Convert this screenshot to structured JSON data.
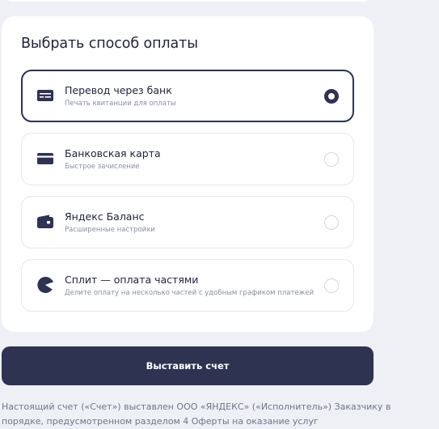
{
  "payment": {
    "title": "Выбрать способ оплаты",
    "options": [
      {
        "title": "Перевод через банк",
        "subtitle": "Печать квитанции для оплаты",
        "icon": "bank-transfer-icon",
        "selected": true
      },
      {
        "title": "Банковская карта",
        "subtitle": "Быстрое зачисление",
        "icon": "bank-card-icon",
        "selected": false
      },
      {
        "title": "Яндекс Баланс",
        "subtitle": "Расширенные настройки",
        "icon": "wallet-icon",
        "selected": false
      },
      {
        "title": "Сплит — оплата частями",
        "subtitle": "Делите оплату на несколько частей с удобным графиком платежей",
        "icon": "split-icon",
        "selected": false
      }
    ]
  },
  "actions": {
    "submit_label": "Выставить счет"
  },
  "legal": {
    "text": "Настоящий счет («Счет») выставлен ООО «ЯНДЕКС» («Исполнитель») Заказчику в порядке, предусмотренном разделом 4 Оферты на оказание услуг"
  },
  "colors": {
    "primary": "#2f3352",
    "background": "#eef0f5",
    "card": "#ffffff",
    "muted_text": "#8a8ea3"
  }
}
